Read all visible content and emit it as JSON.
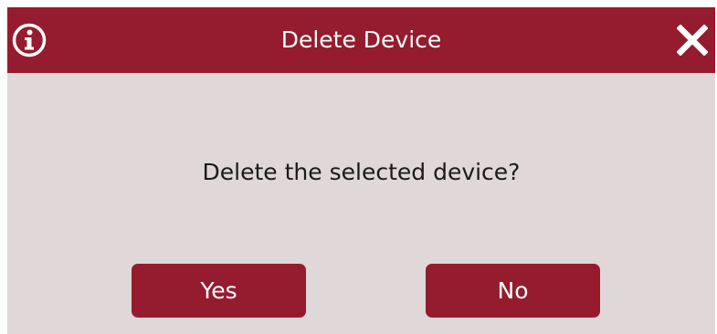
{
  "dialog": {
    "title": "Delete Device",
    "message": "Delete the selected device?",
    "buttons": {
      "yes_label": "Yes",
      "no_label": "No"
    },
    "icons": {
      "info": "info-icon",
      "close": "close-icon"
    },
    "colors": {
      "accent": "#951b2e",
      "body_background": "#e0d8d8",
      "text_on_accent": "#ffffff",
      "message_text": "#1a1a1a"
    }
  }
}
